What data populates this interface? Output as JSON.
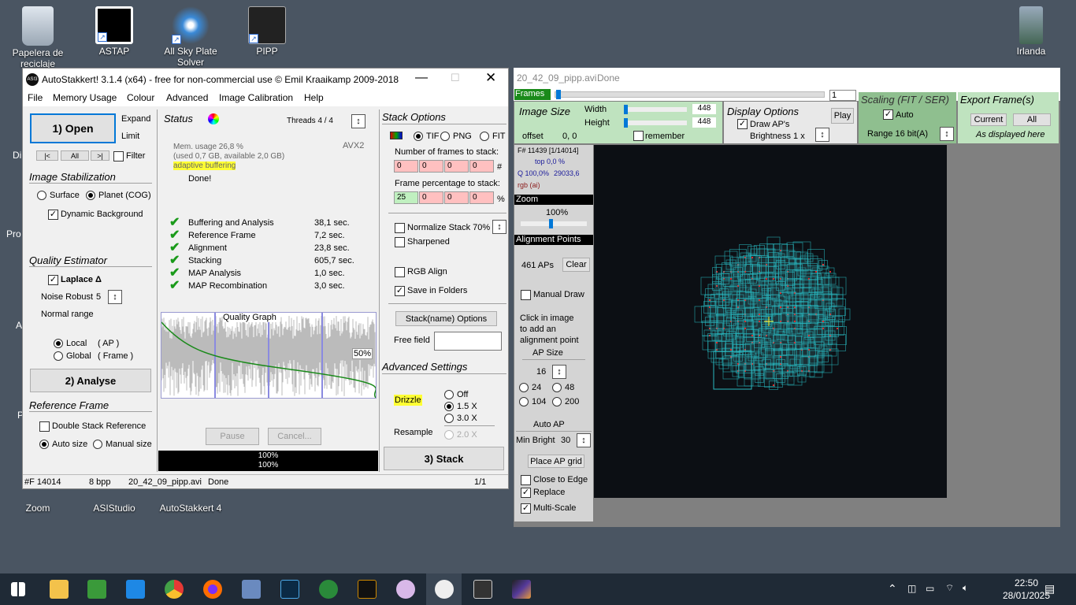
{
  "desktop": {
    "icons": [
      {
        "label": "Papelera de reciclaje"
      },
      {
        "label": "ASTAP"
      },
      {
        "label": "All Sky Plate Solver"
      },
      {
        "label": "PIPP"
      },
      {
        "label": "Irlanda"
      },
      {
        "label": "Zoom"
      },
      {
        "label": "ASIStudio"
      },
      {
        "label": "AutoStakkert 4"
      }
    ],
    "partial_labels": [
      "Di",
      "Pro",
      "A",
      "P"
    ]
  },
  "autostakkert": {
    "title": "AutoStakkert! 3.1.4 (x64) - free for non-commercial use © Emil Kraaikamp 2009-2018",
    "app_icon": "AS!3",
    "menu": [
      "File",
      "Memory Usage",
      "Colour",
      "Advanced",
      "Image Calibration",
      "Help"
    ],
    "open_label": "1) Open",
    "expand": "Expand",
    "limit": "Limit",
    "nav": [
      "|<",
      "All",
      ">|"
    ],
    "filter": "Filter",
    "image_stabilization": {
      "heading": "Image Stabilization",
      "surface": "Surface",
      "planet": "Planet (COG)",
      "dynamic_bg": "Dynamic Background"
    },
    "quality_estimator": {
      "heading": "Quality Estimator",
      "laplace": "Laplace Δ",
      "noise_robust": "Noise Robust",
      "noise_value": "5",
      "normal_range": "Normal range",
      "local": "Local",
      "local_ap": "( AP )",
      "global": "Global",
      "global_frame": "( Frame )"
    },
    "analyse_label": "2) Analyse",
    "reference_frame": {
      "heading": "Reference Frame",
      "double_stack": "Double Stack Reference",
      "auto_size": "Auto size",
      "manual_size": "Manual size"
    },
    "status": {
      "heading": "Status",
      "threads": "Threads 4 / 4",
      "mem_usage": "Mem. usage 26,8 %",
      "mem_detail": "(used 0,7 GB, available 2,0 GB)",
      "adaptive": "adaptive buffering",
      "avx": "AVX2",
      "done": "Done!",
      "steps": [
        {
          "name": "Buffering and Analysis",
          "time": "38,1 sec."
        },
        {
          "name": "Reference Frame",
          "time": "7,2 sec."
        },
        {
          "name": "Alignment",
          "time": "23,8 sec."
        },
        {
          "name": "Stacking",
          "time": "605,7 sec."
        },
        {
          "name": "MAP Analysis",
          "time": "1,0 sec."
        },
        {
          "name": "MAP Recombination",
          "time": "3,0 sec."
        }
      ],
      "graph_title": "Quality Graph",
      "graph_pct": "50%",
      "pause": "Pause",
      "cancel": "Cancel...",
      "progress1": "100%",
      "progress2": "100%"
    },
    "stack_options": {
      "heading": "Stack Options",
      "tif": "TIF",
      "png": "PNG",
      "fit": "FIT",
      "frames_label": "Number of frames to stack:",
      "frames_values": [
        "0",
        "0",
        "0",
        "0"
      ],
      "frames_suffix": "#",
      "pct_label": "Frame percentage to stack:",
      "pct_values": [
        "25",
        "0",
        "0",
        "0"
      ],
      "pct_suffix": "%",
      "normalize": "Normalize Stack 70%",
      "sharpened": "Sharpened",
      "rgb_align": "RGB Align",
      "save_folders": "Save in Folders",
      "stack_name_opts": "Stack(name) Options",
      "free_field": "Free field"
    },
    "advanced": {
      "heading": "Advanced Settings",
      "drizzle": "Drizzle",
      "off": "Off",
      "x15": "1.5 X",
      "x30": "3.0 X",
      "resample": "Resample",
      "x20": "2.0 X"
    },
    "stack_label": "3) Stack",
    "statusbar": {
      "frames": "#F 14014",
      "bpp": "8 bpp",
      "file": "20_42_09_pipp.avi",
      "state": "Done",
      "page": "1/1"
    }
  },
  "pipp": {
    "title": "20_42_09_pipp.avi",
    "title_state": "Done",
    "frames_label": "Frames",
    "frames_value": "1",
    "image_size": {
      "heading": "Image Size",
      "width_label": "Width",
      "width": "448",
      "height_label": "Height",
      "height": "448",
      "offset": "offset",
      "offset_val": "0, 0",
      "remember": "remember"
    },
    "display": {
      "heading": "Display Options",
      "draw_aps": "Draw AP's",
      "brightness": "Brightness 1 x",
      "play": "Play"
    },
    "scaling": {
      "heading": "Scaling (FIT / SER)",
      "auto": "Auto",
      "range": "Range 16 bit(A)"
    },
    "export": {
      "heading": "Export Frame(s)",
      "current": "Current",
      "all": "All",
      "as_displayed": "As displayed here"
    },
    "info": {
      "frame": "F# 11439 [1/14014]",
      "top": "top 0,0 %",
      "q": "Q 100,0%",
      "q_val": "29033,6",
      "rgb": "rgb (ai)"
    },
    "zoom": {
      "heading": "Zoom",
      "value": "100%"
    },
    "ap": {
      "heading": "Alignment Points",
      "count": "461 APs",
      "clear": "Clear",
      "manual_draw": "Manual Draw",
      "help1": "Click in image",
      "help2": "to add an",
      "help3": "alignment point",
      "ap_size": "AP Size",
      "size_val": "16",
      "s24": "24",
      "s48": "48",
      "s104": "104",
      "s200": "200",
      "auto_ap": "Auto AP",
      "min_bright": "Min Bright",
      "min_val": "30",
      "place_grid": "Place AP grid",
      "close_edge": "Close to Edge",
      "replace": "Replace",
      "multi_scale": "Multi-Scale"
    }
  },
  "taskbar": {
    "time": "22:50",
    "date": "28/01/2025"
  },
  "colors": {
    "accent": "#0078d7",
    "drizzle_bg": "#ffff33",
    "frames_box": "#ffc0c0",
    "green_panel": "#bfe3bf",
    "graph_line": "#1a8a1a"
  }
}
